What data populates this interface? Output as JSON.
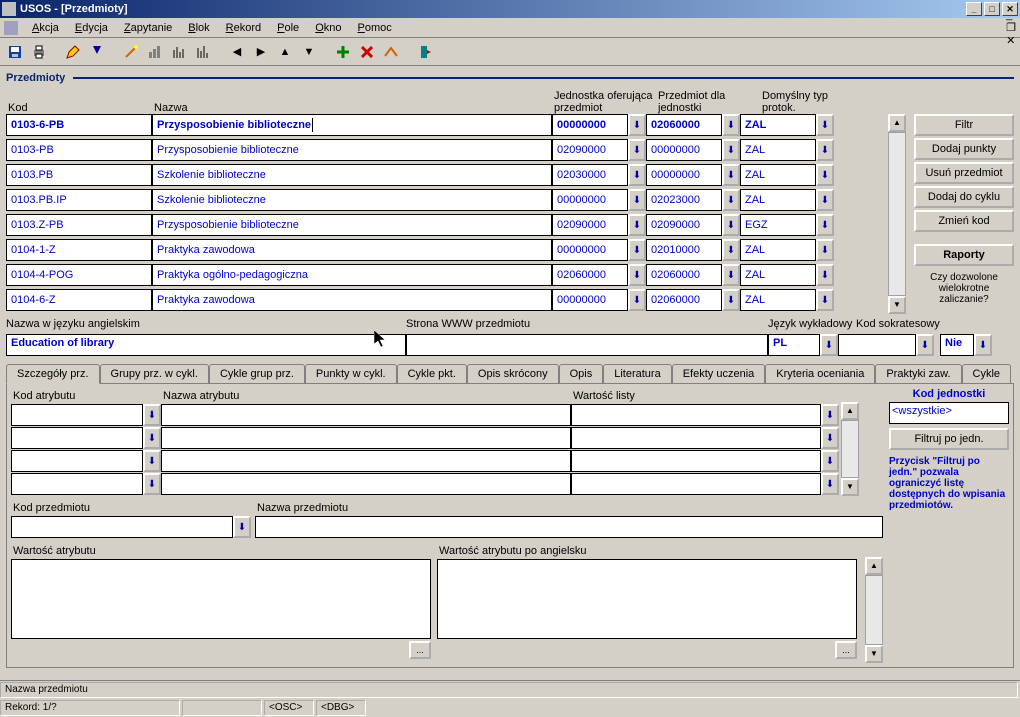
{
  "window": {
    "title": "USOS - [Przedmioty]"
  },
  "menu": [
    "Akcja",
    "Edycja",
    "Zapytanie",
    "Blok",
    "Rekord",
    "Pole",
    "Okno",
    "Pomoc"
  ],
  "section_title": "Przedmioty",
  "grid": {
    "headers": {
      "kod": "Kod",
      "nazwa": "Nazwa",
      "jednostka": "Jednostka oferująca przedmiot",
      "przedmiot_dla": "Przedmiot dla jednostki",
      "domyslny": "Domyślny typ protok."
    },
    "rows": [
      {
        "kod": "0103-6-PB",
        "nazwa": "Przysposobienie biblioteczne",
        "j": "00000000",
        "p": "02060000",
        "d": "ZAL",
        "sel": true
      },
      {
        "kod": "0103-PB",
        "nazwa": "Przysposobienie biblioteczne",
        "j": "02090000",
        "p": "00000000",
        "d": "ZAL"
      },
      {
        "kod": "0103.PB",
        "nazwa": "Szkolenie biblioteczne",
        "j": "02030000",
        "p": "00000000",
        "d": "ZAL"
      },
      {
        "kod": "0103.PB.IP",
        "nazwa": "Szkolenie biblioteczne",
        "j": "00000000",
        "p": "02023000",
        "d": "ZAL"
      },
      {
        "kod": "0103.Z-PB",
        "nazwa": "Przysposobienie biblioteczne",
        "j": "02090000",
        "p": "02090000",
        "d": "EGZ"
      },
      {
        "kod": "0104-1-Z",
        "nazwa": "Praktyka zawodowa",
        "j": "00000000",
        "p": "02010000",
        "d": "ZAL"
      },
      {
        "kod": "0104-4-POG",
        "nazwa": "Praktyka ogólno-pedagogiczna",
        "j": "02060000",
        "p": "02060000",
        "d": "ZAL"
      },
      {
        "kod": "0104-6-Z",
        "nazwa": "Praktyka zawodowa",
        "j": "00000000",
        "p": "02060000",
        "d": "ZAL"
      }
    ]
  },
  "side_buttons": {
    "filtr": "Filtr",
    "dodaj_punkty": "Dodaj punkty",
    "usun": "Usuń przedmiot",
    "dodaj_cykl": "Dodaj do cyklu",
    "zmien": "Zmień kod",
    "raporty": "Raporty"
  },
  "side_note": "Czy dozwolone wielokrotne zaliczanie?",
  "row2": {
    "nazwa_ang_label": "Nazwa w języku angielskim",
    "nazwa_ang_value": "Education of library",
    "strona_label": "Strona WWW przedmiotu",
    "strona_value": "",
    "jezyk_label": "Język wykładowy",
    "jezyk_value": "PL",
    "sokr_label": "Kod sokratesowy",
    "sokr_value": "",
    "nie": "Nie"
  },
  "tabs": [
    "Szczegóły prz.",
    "Grupy prz. w cykl.",
    "Cykle grup prz.",
    "Punkty w cykl.",
    "Cykle pkt.",
    "Opis skrócony",
    "Opis",
    "Literatura",
    "Efekty uczenia",
    "Kryteria oceniania",
    "Praktyki zaw.",
    "Cykle"
  ],
  "attr": {
    "kod_atr": "Kod atrybutu",
    "nazwa_atr": "Nazwa atrybutu",
    "wartosc_listy": "Wartość listy",
    "kod_przedmiotu": "Kod przedmiotu",
    "nazwa_przedmiotu": "Nazwa przedmiotu",
    "wartosc_atr": "Wartość atrybutu",
    "wartosc_atr_ang": "Wartość atrybutu po angielsku",
    "kod_jednostki": "Kod jednostki",
    "wszystkie": "<wszystkie>",
    "filtruj": "Filtruj po jedn.",
    "help": "Przycisk \"Filtruj po jedn.\" pozwala ograniczyć listę dostępnych do wpisania przedmiotów."
  },
  "status": {
    "nazwa_label": "Nazwa przedmiotu",
    "rekord": "Rekord: 1/?",
    "osc": "<OSC>",
    "dbg": "<DBG>"
  }
}
